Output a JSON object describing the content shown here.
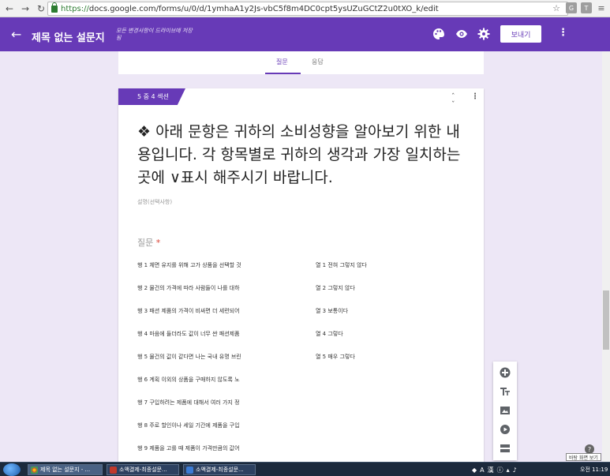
{
  "browser": {
    "url_https": "https://",
    "url_rest": "docs.google.com/forms/u/0/d/1ymhaA1y2Js-vbC5f8m4DC0cpt5ysUZuGCtZ2u0tXO_k/edit"
  },
  "header": {
    "title": "제목 없는 설문지",
    "save_note": "모든 변경사항이 드라이브에 저장됨",
    "send_label": "보내기"
  },
  "tabs": {
    "questions": "질문",
    "responses": "응답"
  },
  "section": {
    "tag": "5 중 4 섹션",
    "title": "❖ 아래 문항은 귀하의 소비성향을 알아보기 위한 내용입니다. 각 항목별로 귀하의 생각과 가장 일치하는 곳에 ∨표시 해주시기 바랍니다.",
    "description": "설명(선택사항)"
  },
  "question": {
    "label": "질문",
    "required_mark": "*",
    "rows": [
      "행 1   체면 유지를 위해 고가 상품을 선택할 것",
      "행 2   물건의 가격에 따라 사람들이 나를 대하",
      "행 3   패션 제품의 가격이 비싸면 더 세련되어",
      "행 4   마음에 들더라도 값이 너무 싼 패션제품",
      "행 5   물건의 값이 같다면 나는 국내 유명 브린",
      "행 6   계획 이외의 상품을 구매하지 않도록 노",
      "행 7   구입하려는 제품에 대해서 여러 가지 정",
      "행 8   주로 할인이나 세일 기간에 제품을 구입",
      "행 9   제품을 고를 때 제품이 가격만큼의 값어"
    ],
    "columns": [
      "열 1   전혀 그렇지 않다",
      "열 2   그렇지 않다",
      "열 3   보통이다",
      "열 4   그렇다",
      "열 5   매우 그렇다"
    ]
  },
  "tooltip": "바탕 화면 보기",
  "taskbar": {
    "tasks": [
      "제목 없는 설문지 - ...",
      "소액결제-최종설문...",
      "소액결제-최종설문..."
    ],
    "clock": "오전 11:19"
  },
  "colors": {
    "accent": "#673ab7",
    "background": "#ede7f6"
  }
}
